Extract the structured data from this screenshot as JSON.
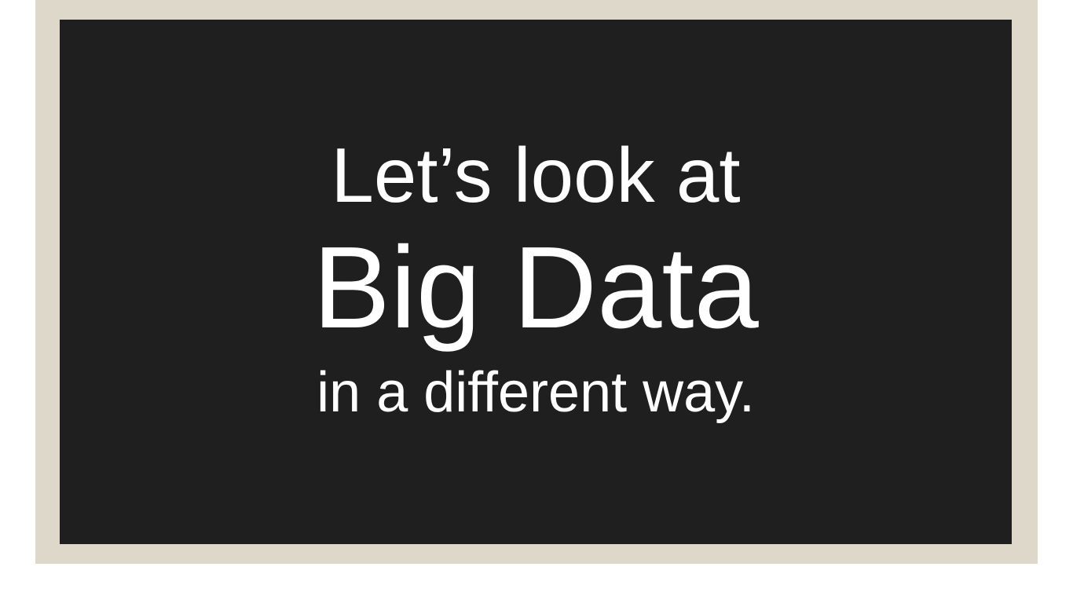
{
  "slide": {
    "line_1": "Let’s look at",
    "line_2": "Big Data",
    "line_3": "in a different way."
  },
  "colors": {
    "frame": "#ddd8c9",
    "background": "#1f1f1f",
    "text": "#ffffff"
  }
}
